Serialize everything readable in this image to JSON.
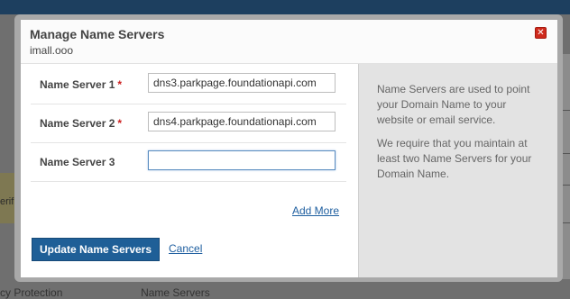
{
  "background": {
    "left_fragment": "erif",
    "bottom_left_text": "cy Protection",
    "bottom_right_text": "Name Servers",
    "right_fragments": [
      "H",
      "S",
      "S",
      "p"
    ]
  },
  "dialog": {
    "title": "Manage Name Servers",
    "subtitle": "imall.ooo",
    "close_glyph": "✕"
  },
  "form": {
    "rows": [
      {
        "label": "Name Server 1",
        "required": "*",
        "value": "dns3.parkpage.foundationapi.com"
      },
      {
        "label": "Name Server 2",
        "required": "*",
        "value": "dns4.parkpage.foundationapi.com"
      },
      {
        "label": "Name Server 3",
        "required": "",
        "value": ""
      }
    ],
    "add_more": "Add More",
    "update_button": "Update Name Servers",
    "cancel": "Cancel"
  },
  "info": {
    "para1": "Name Servers are used to point your Domain Name to your website or email service.",
    "para2": "We require that you maintain at least two Name Servers for your Domain Name."
  },
  "colors": {
    "primary_button": "#1f5f97",
    "link": "#1f5fa0",
    "required": "#cc1f1f",
    "close": "#cf2a1c"
  }
}
